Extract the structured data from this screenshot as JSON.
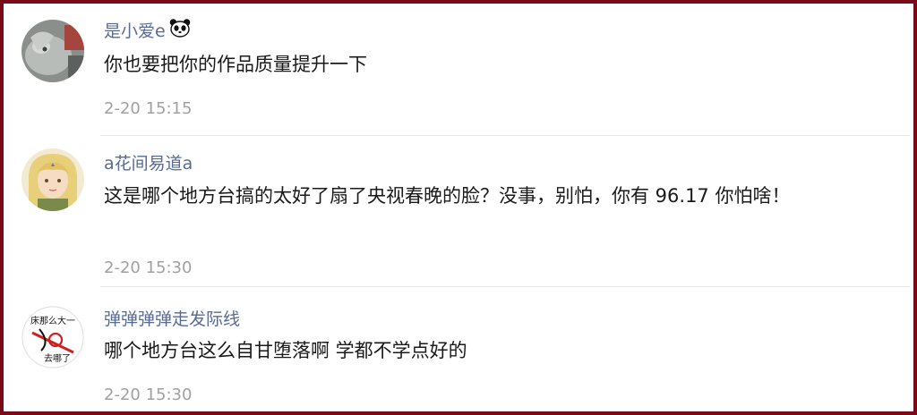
{
  "comments": [
    {
      "username": "是小爱e",
      "username_icon": "panda-face-icon",
      "text": "你也要把你的作品质量提升一下",
      "time": "2-20 15:15",
      "avatar": "gray-animal-photo-avatar"
    },
    {
      "username": "a花间易道a",
      "text": "这是哪个地方台搞的太好了扇了央视春晚的脸？没事，别怕，你有 96.17 你怕啥！",
      "time": "2-20 15:30",
      "avatar": "blonde-anime-character-avatar"
    },
    {
      "username": "弹弹弹弹走发际线",
      "text": "哪个地方台这么自甘堕落啊 学都不学点好的",
      "time": "2-20 15:30",
      "avatar": "sketch-text-avatar",
      "avatar_text_top": "床那么大一",
      "avatar_text_bottom": "去哪了"
    }
  ],
  "colors": {
    "border": "#7a0a1a",
    "username": "#576b95",
    "text": "#1a1a1a",
    "timestamp": "#a0a0a0",
    "divider": "#e8e8e8"
  }
}
